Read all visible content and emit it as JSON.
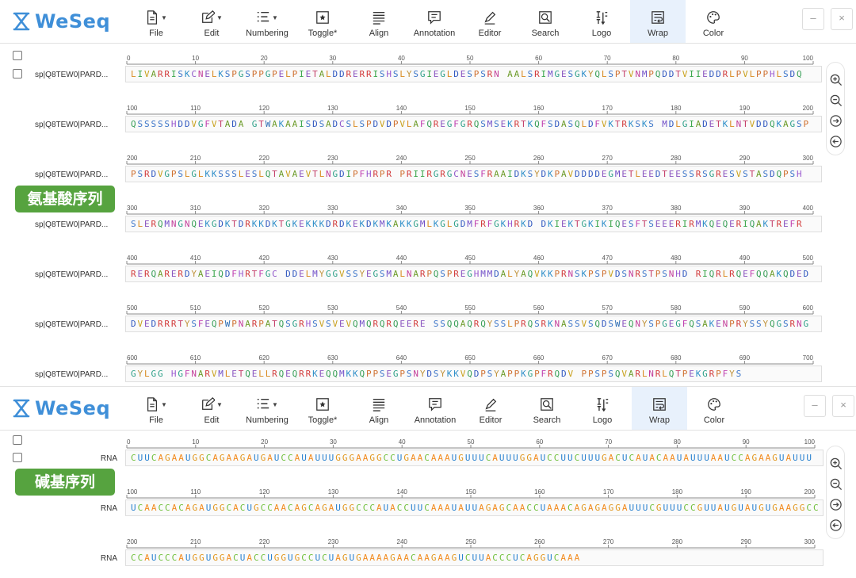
{
  "app": {
    "logo_text": "WeSeq"
  },
  "toolbar": {
    "items": [
      {
        "label": "File",
        "icon": "file-icon",
        "dropdown": true
      },
      {
        "label": "Edit",
        "icon": "edit-icon",
        "dropdown": true
      },
      {
        "label": "Numbering",
        "icon": "numbering-icon",
        "dropdown": true
      },
      {
        "label": "Toggle*",
        "icon": "toggle-icon",
        "dropdown": false
      },
      {
        "label": "Align",
        "icon": "align-icon",
        "dropdown": false
      },
      {
        "label": "Annotation",
        "icon": "annotation-icon",
        "dropdown": false
      },
      {
        "label": "Editor",
        "icon": "editor-icon",
        "dropdown": false
      },
      {
        "label": "Search",
        "icon": "search-icon",
        "dropdown": false
      },
      {
        "label": "Logo",
        "icon": "logo-icon",
        "dropdown": false
      },
      {
        "label": "Wrap",
        "icon": "wrap-icon",
        "dropdown": false,
        "active": true
      },
      {
        "label": "Color",
        "icon": "color-icon",
        "dropdown": false
      }
    ],
    "window_buttons": [
      "–",
      "×"
    ]
  },
  "side_buttons": [
    "zoom-in-icon",
    "zoom-out-icon",
    "arrow-right-icon",
    "arrow-left-icon"
  ],
  "protein_panel": {
    "tag": "氨基酸序列",
    "row_label": "sp|Q8TEW0|PARD...",
    "ruler_step": 10,
    "rows": [
      {
        "start": 0,
        "end": 100,
        "sequence": "LIVARRISKCNELKSPGSPPGPELPIETALDDRERRISHSLYSGIEGLDESPSRN AALSRIMGESGKYQLSPTVNMPQDDTVIIEDDRLPVLPPHLSDQ"
      },
      {
        "start": 100,
        "end": 200,
        "sequence": "QSSSSSHDDVGFVTADA GTWAKAAISDSADCSLSPDVDPVLAFQREGFGRQSMSEKRTKQFSDASQLDFVKTRKSKS MDLGIADETKLNTVDDQKAGSP"
      },
      {
        "start": 200,
        "end": 300,
        "sequence": "PSRDVGPSLGLKKSSSLESLQTAVAEVTLNGDIPFHRPR PRIIRGRGCNESFRAAIDKSYDKPAVDDDDEGMETLEEDTEESSRSGRESVSTASDQPSH"
      },
      {
        "start": 300,
        "end": 400,
        "sequence": "SLERQMNGNQEKGDKTDRKKDKTGKEKKKDRDKEKDKMKAKKGMLKGLGDMFRFGKHRKD DKIEKTGKIKIQESFTSEEERIRMKQEQERIQAKTREFR"
      },
      {
        "start": 400,
        "end": 500,
        "sequence": "RERQARERDYAEIQDFHRTFGC DDELMYGGVSSYEGSMALNARPQSPREGHMMDALYAQVKKPRNSKPSPVDSNRSTPSNHD RIQRLRQEFQQAKQDED"
      },
      {
        "start": 500,
        "end": 600,
        "sequence": "DVEDRRRTYSFEQPWPNARPATQSGRHSVSVEVQMQRQRQEERE SSQQAQRQYSSLPRQSRKNASSVSQDSWEQNYSPGEGFQSAKENPRYSSYQGSRNG"
      },
      {
        "start": 600,
        "end": 700,
        "sequence": "GYLGG HGFNARVMLETQELLRQEQRRKEQQMKKQPPSEGPSNYDSYKKVQDPSYAPPKGPFRQDV PPSPSQVARLNRLQTPEKGRPFYS"
      }
    ]
  },
  "rna_panel": {
    "tag": "碱基序列",
    "row_label": "RNA",
    "ruler_step": 10,
    "rows": [
      {
        "start": 0,
        "end": 100,
        "sequence": "CUUCAGAAUGGCAGAAGAUGAUCCAUAUUUGGGAAGGCCUGAACAAAUGUUUCAUUUGGAUCCUUCUUUGACUCAUACAAUAUUUAAUCCAGAAGUAUUU"
      },
      {
        "start": 100,
        "end": 200,
        "sequence": "UCAACCACAGAUGGCACUGCCAACAGCAGAUGGCCCAUACCUUCAAAUAUUAGAGCAACCUAAACAGAGAGGAUUUCGUUUCCGUUAUGUAUGUGAAGGCC"
      },
      {
        "start": 200,
        "end": 300,
        "sequence": "CCAUCCCAUGGUGGACUACCUGGUGCCUCUAGUGAAAAGAACAAGAAGUCUUACCCUCAGGUCAAA"
      }
    ]
  },
  "colors": {
    "protein": {
      "L": "#d98a1f",
      "I": "#3aa64a",
      "V": "#c9a11d",
      "A": "#6d9c2a",
      "R": "#d23b3b",
      "S": "#3c75c9",
      "K": "#2f8fc9",
      "C": "#8f56c9",
      "N": "#c33d9a",
      "E": "#8a55c0",
      "P": "#cf7030",
      "G": "#2fa089",
      "T": "#c43f6a",
      "D": "#3158c0",
      "H": "#9a5ad0",
      "Y": "#c0923a",
      "M": "#6f4cc7",
      "Q": "#3ba05a",
      "F": "#c03fb0",
      "W": "#2f6fb5"
    },
    "rna": {
      "A": "#f28a1d",
      "U": "#2a82d0",
      "G": "#e1961c",
      "C": "#6fbf3a"
    },
    "tag_bg": "#56a33f",
    "logo": "#3f8fd8",
    "active_tool": "#e8f1fc"
  }
}
